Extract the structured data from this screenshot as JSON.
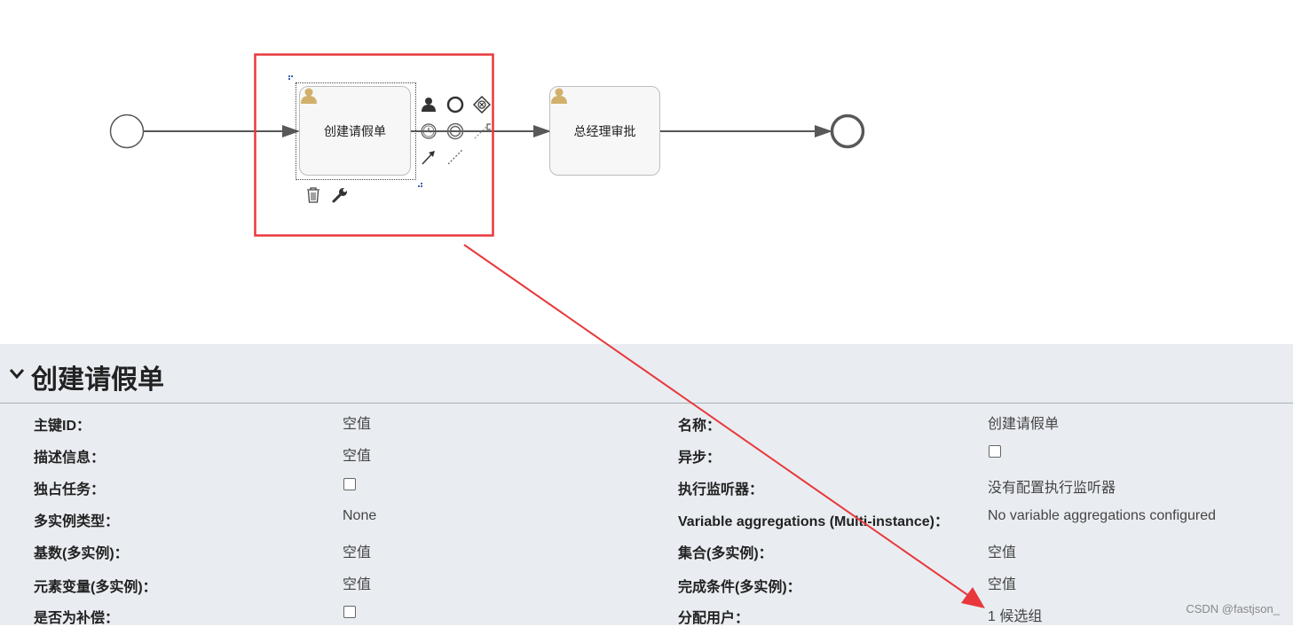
{
  "diagram": {
    "tasks": [
      {
        "label": "创建请假单"
      },
      {
        "label": "总经理审批"
      }
    ]
  },
  "props": {
    "title": "创建请假单",
    "rows_left": [
      {
        "label": "主键ID：",
        "value": "空值"
      },
      {
        "label": "描述信息：",
        "value": "空值"
      },
      {
        "label": "独占任务：",
        "value": ""
      },
      {
        "label": "多实例类型：",
        "value": "None"
      },
      {
        "label": "基数(多实例)：",
        "value": "空值"
      },
      {
        "label": "元素变量(多实例)：",
        "value": "空值"
      },
      {
        "label": "是否为补偿：",
        "value": ""
      }
    ],
    "rows_right": [
      {
        "label": "名称：",
        "value": "创建请假单"
      },
      {
        "label": "异步：",
        "value": ""
      },
      {
        "label": "执行监听器：",
        "value": "没有配置执行监听器"
      },
      {
        "label": "Variable aggregations (Multi-instance)：",
        "value": "No variable aggregations configured"
      },
      {
        "label": "集合(多实例)：",
        "value": "空值"
      },
      {
        "label": "完成条件(多实例)：",
        "value": "空值"
      },
      {
        "label": "分配用户：",
        "value": "1 候选组"
      }
    ]
  },
  "watermark": "CSDN @fastjson_",
  "colors": {
    "annotation_red": "#e8383b",
    "panel_bg": "#e9edf1",
    "task_bg": "#f7f7f7",
    "user_icon": "#d1b06b",
    "flow_line": "#585858"
  }
}
